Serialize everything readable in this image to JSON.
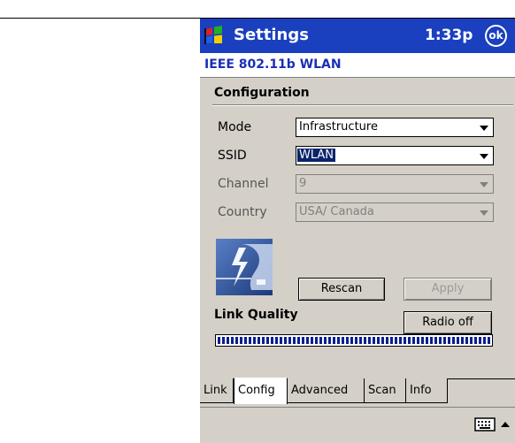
{
  "titlebar": {
    "title": "Settings",
    "clock": "1:33p",
    "ok_label": "ok"
  },
  "subtitle": "IEEE 802.11b WLAN",
  "configuration": {
    "section_label": "Configuration",
    "fields": {
      "mode": {
        "label": "Mode",
        "value": "Infrastructure",
        "enabled": true
      },
      "ssid": {
        "label": "SSID",
        "value": "WLAN",
        "enabled": true,
        "selected": true
      },
      "channel": {
        "label": "Channel",
        "value": "9",
        "enabled": false
      },
      "country": {
        "label": "Country",
        "value": "USA/ Canada",
        "enabled": false
      }
    }
  },
  "buttons": {
    "rescan": "Rescan",
    "apply": "Apply",
    "radio_off": "Radio off"
  },
  "link_quality": {
    "label": "Link Quality",
    "level": 1.0
  },
  "tabs": [
    {
      "label": "Link",
      "active": false
    },
    {
      "label": "Config",
      "active": true
    },
    {
      "label": "Advanced",
      "active": false
    },
    {
      "label": "Scan",
      "active": false
    },
    {
      "label": "Info",
      "active": false
    }
  ],
  "icons": {
    "start": "windows-flag-icon",
    "keyboard": "keyboard-icon",
    "sip_arrow": "chevron-up-icon",
    "card": "wlan-card-icon"
  },
  "colors": {
    "titlebar": "#1a3fbf",
    "subtitle_text": "#1a2fb5",
    "panel": "#d4d0c8",
    "quality_fill": "#0a1f8f"
  }
}
